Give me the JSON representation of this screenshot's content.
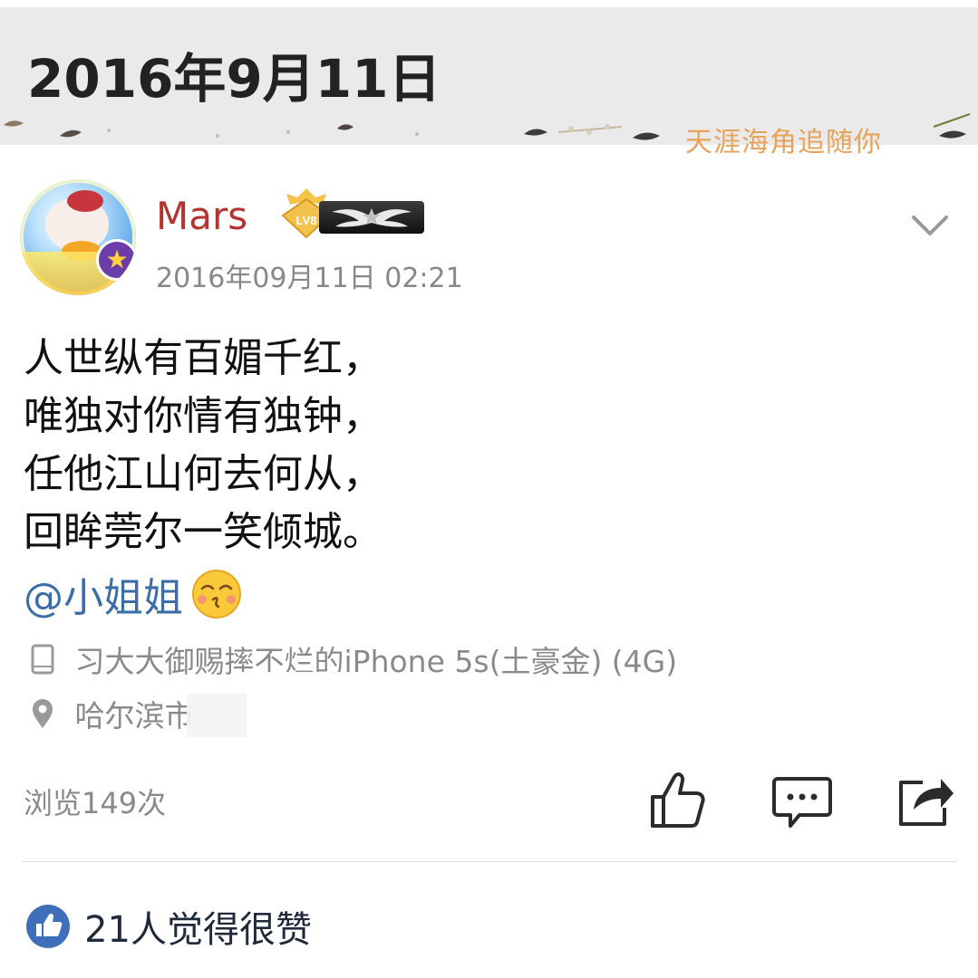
{
  "header": {
    "date": "2016年9月11日",
    "banner_text": "天涯海角追随你"
  },
  "post": {
    "author": "Mars",
    "level_badge": "LV8",
    "timestamp": "2016年09月11日 02:21",
    "lines": [
      "人世纵有百媚千红，",
      "唯独对你情有独钟，",
      "任他江山何去何从，",
      "回眸莞尔一笑倾城。"
    ],
    "mention": "@小姐姐",
    "device": "习大大御赐摔不烂的iPhone 5s(土豪金) (4G)",
    "location": "哈尔滨市"
  },
  "footer": {
    "views": "浏览149次",
    "likes_summary": "21人觉得很赞"
  },
  "icons": {
    "like": "thumbs-up-icon",
    "comment": "comment-icon",
    "share": "share-icon",
    "device": "phone-icon",
    "location": "location-pin-icon",
    "more": "chevron-down-icon"
  },
  "colors": {
    "username": "#b53330",
    "mention": "#3a6ea8",
    "meta": "#8a8a8a",
    "likes_badge": "#3f6fb8"
  }
}
